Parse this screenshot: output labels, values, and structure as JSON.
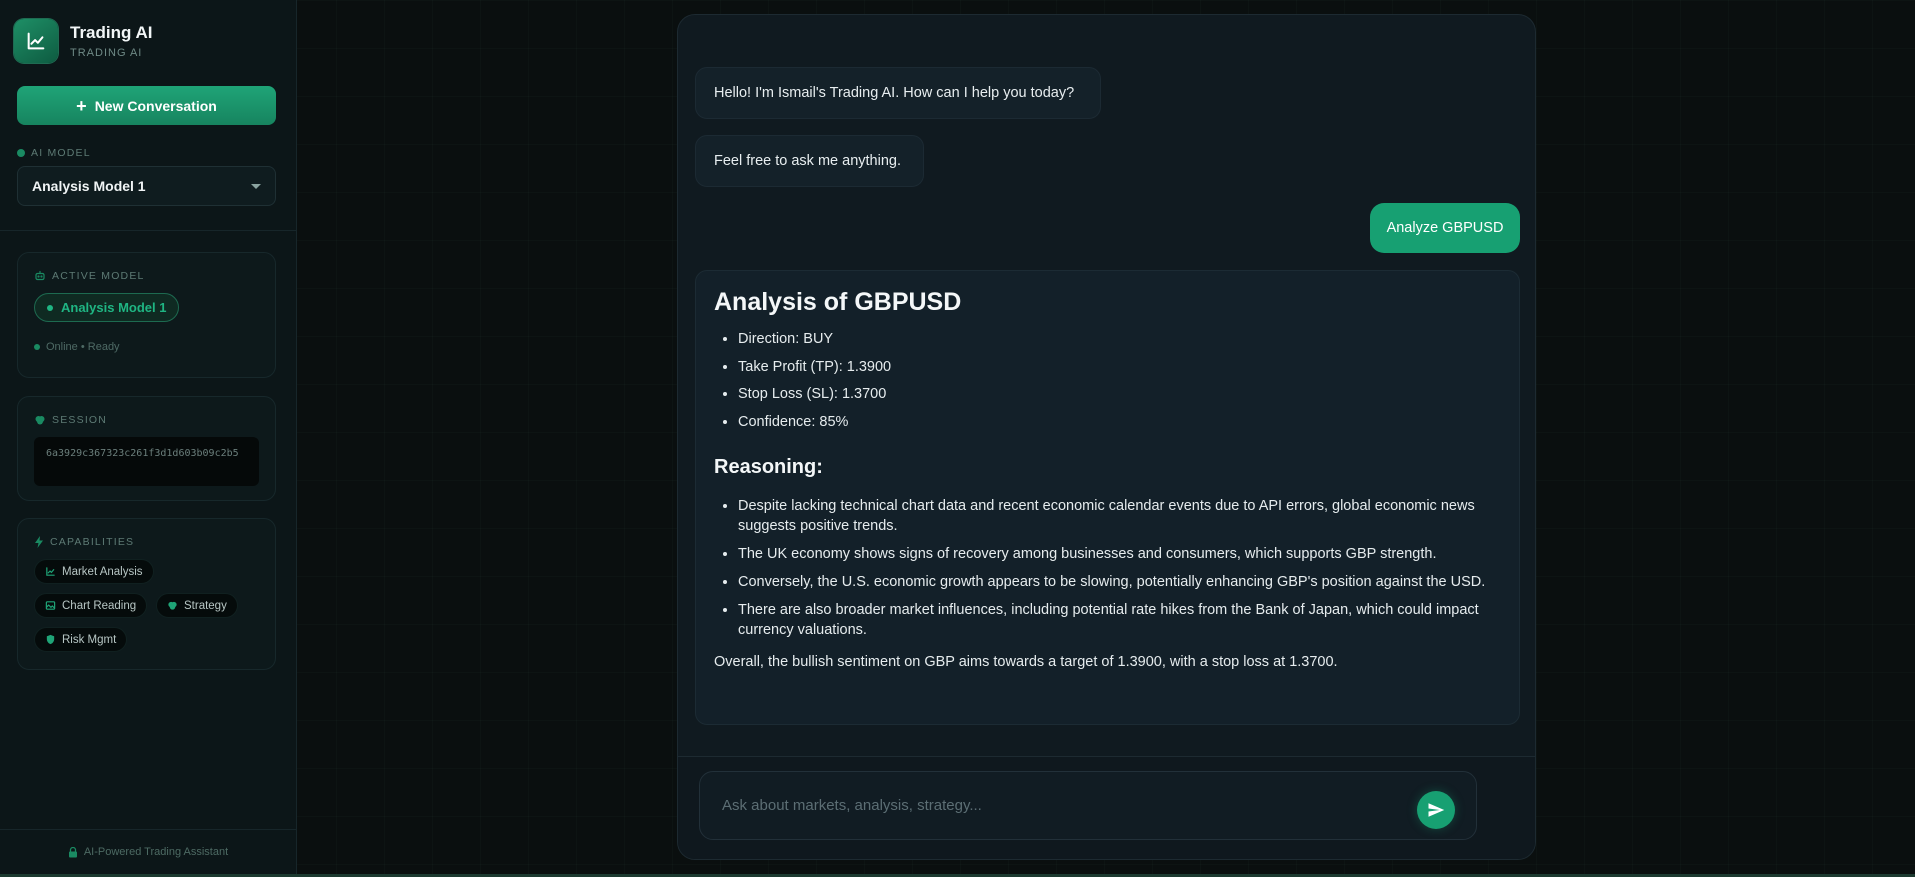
{
  "brand": {
    "title": "Trading AI",
    "subtitle": "TRADING AI"
  },
  "sidebar": {
    "new_conversation_label": "New Conversation",
    "ai_model_label": "AI MODEL",
    "ai_model_selected": "Analysis Model 1",
    "active_model": {
      "label": "ACTIVE MODEL",
      "name": "Analysis Model 1",
      "status": "Online • Ready"
    },
    "session": {
      "label": "SESSION",
      "id": "6a3929c367323c261f3d1d603b09c2b5"
    },
    "capabilities": {
      "label": "CAPABILITIES",
      "items": [
        "Market Analysis",
        "Chart Reading",
        "Strategy",
        "Risk Mgmt"
      ]
    },
    "footer": "AI-Powered Trading Assistant"
  },
  "chat": {
    "messages": [
      {
        "role": "assistant",
        "text": "Hello! I'm Ismail's Trading AI. How can I help you today?"
      },
      {
        "role": "assistant",
        "text": "Feel free to ask me anything."
      },
      {
        "role": "user",
        "text": "Analyze GBPUSD"
      }
    ],
    "analysis": {
      "title": "Analysis of GBPUSD",
      "summary_items": [
        "Direction: BUY",
        "Take Profit (TP): 1.3900",
        "Stop Loss (SL): 1.3700",
        "Confidence: 85%"
      ],
      "reasoning_title": "Reasoning:",
      "reasoning_items": [
        "Despite lacking technical chart data and recent economic calendar events due to API errors, global economic news suggests positive trends.",
        "The UK economy shows signs of recovery among businesses and consumers, which supports GBP strength.",
        "Conversely, the U.S. economic growth appears to be slowing, potentially enhancing GBP's position against the USD.",
        "There are also broader market influences, including potential rate hikes from the Bank of Japan, which could impact currency valuations."
      ],
      "conclusion": "Overall, the bullish sentiment on GBP aims towards a target of 1.3900, with a stop loss at 1.3700."
    },
    "input": {
      "placeholder": "Ask about markets, analysis, strategy...",
      "value": ""
    }
  },
  "colors": {
    "accent": "#17a072",
    "background": "#0a0f0f",
    "panel": "#101a20"
  }
}
